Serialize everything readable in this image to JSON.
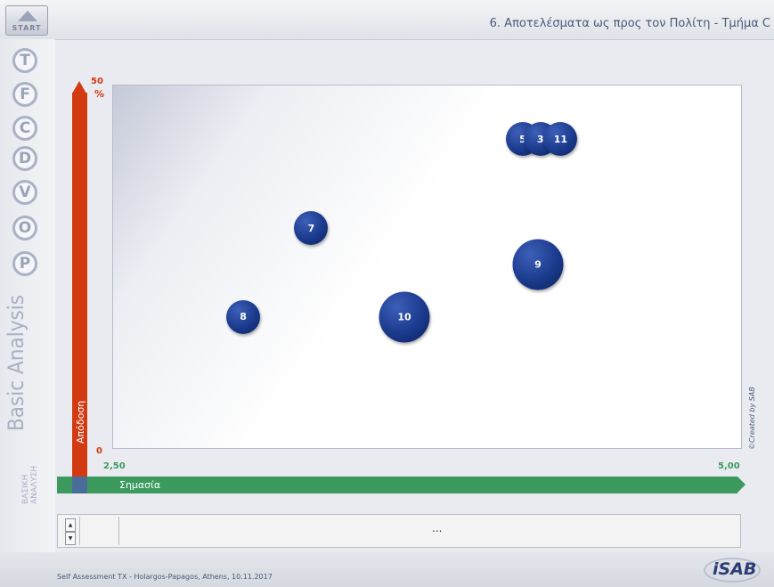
{
  "header": {
    "title": "6. Αποτελέσματα ως προς τον Πολίτη - Τμήμα C",
    "start_label": "START"
  },
  "sidebar": {
    "items": [
      {
        "letter": "T",
        "icon": "tool-t-icon"
      },
      {
        "letter": "F",
        "icon": "tool-f-icon"
      },
      {
        "letter": "C",
        "icon": "tool-c-icon"
      },
      {
        "letter": "D",
        "icon": "tool-d-icon"
      },
      {
        "letter": "V",
        "icon": "tool-v-icon"
      },
      {
        "letter": "O",
        "icon": "tool-o-icon"
      },
      {
        "letter": "P",
        "icon": "tool-p-icon"
      }
    ],
    "title": "Basic Analysis",
    "subtitle_line1": "ΒΑΣΙΚΗ",
    "subtitle_line2": "ΑΝΑΛΥΣΗ"
  },
  "chart_data": {
    "type": "scatter",
    "xlabel": "Σημασία",
    "ylabel": "Απόδοση",
    "xlim": [
      2.5,
      5.0
    ],
    "ylim": [
      0,
      50
    ],
    "x_tick_labels": [
      "2,50",
      "5,00"
    ],
    "y_tick_labels": [
      "0",
      "50"
    ],
    "y_unit": "%",
    "points": [
      {
        "label": "5",
        "x": 4.13,
        "y": 42.5,
        "size": 1
      },
      {
        "label": "3",
        "x": 4.2,
        "y": 42.5,
        "size": 1
      },
      {
        "label": "11",
        "x": 4.28,
        "y": 42.5,
        "size": 1
      },
      {
        "label": "7",
        "x": 3.29,
        "y": 30.3,
        "size": 1
      },
      {
        "label": "9",
        "x": 4.19,
        "y": 25.3,
        "size": 1.5
      },
      {
        "label": "8",
        "x": 3.02,
        "y": 18.1,
        "size": 1
      },
      {
        "label": "10",
        "x": 3.66,
        "y": 18.1,
        "size": 1.5
      }
    ],
    "credit": "©Created by SAB"
  },
  "bottom_panel": {
    "text": "...",
    "scroll_up": "▲",
    "scroll_down": "▼"
  },
  "footer": {
    "text": "Self Assessment TX - Holargos-Papagos, Athens, 10.11.2017",
    "logo": "iSAB"
  },
  "colors": {
    "y_axis": "#d23a12",
    "x_axis": "#3d9a5f",
    "bubble": "#1a3a8c"
  }
}
